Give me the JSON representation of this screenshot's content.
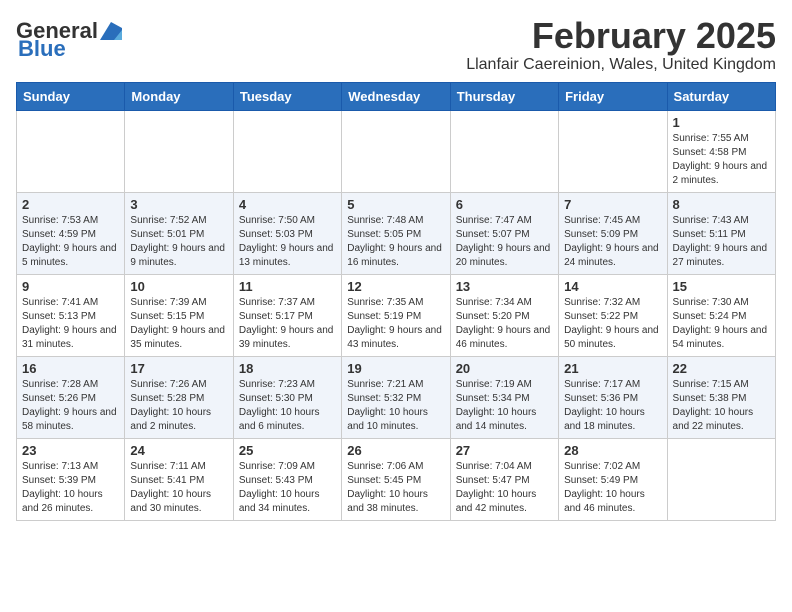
{
  "header": {
    "logo_general": "General",
    "logo_blue": "Blue",
    "month_year": "February 2025",
    "location": "Llanfair Caereinion, Wales, United Kingdom"
  },
  "days_of_week": [
    "Sunday",
    "Monday",
    "Tuesday",
    "Wednesday",
    "Thursday",
    "Friday",
    "Saturday"
  ],
  "weeks": [
    [
      {
        "day": "",
        "info": ""
      },
      {
        "day": "",
        "info": ""
      },
      {
        "day": "",
        "info": ""
      },
      {
        "day": "",
        "info": ""
      },
      {
        "day": "",
        "info": ""
      },
      {
        "day": "",
        "info": ""
      },
      {
        "day": "1",
        "info": "Sunrise: 7:55 AM\nSunset: 4:58 PM\nDaylight: 9 hours and 2 minutes."
      }
    ],
    [
      {
        "day": "2",
        "info": "Sunrise: 7:53 AM\nSunset: 4:59 PM\nDaylight: 9 hours and 5 minutes."
      },
      {
        "day": "3",
        "info": "Sunrise: 7:52 AM\nSunset: 5:01 PM\nDaylight: 9 hours and 9 minutes."
      },
      {
        "day": "4",
        "info": "Sunrise: 7:50 AM\nSunset: 5:03 PM\nDaylight: 9 hours and 13 minutes."
      },
      {
        "day": "5",
        "info": "Sunrise: 7:48 AM\nSunset: 5:05 PM\nDaylight: 9 hours and 16 minutes."
      },
      {
        "day": "6",
        "info": "Sunrise: 7:47 AM\nSunset: 5:07 PM\nDaylight: 9 hours and 20 minutes."
      },
      {
        "day": "7",
        "info": "Sunrise: 7:45 AM\nSunset: 5:09 PM\nDaylight: 9 hours and 24 minutes."
      },
      {
        "day": "8",
        "info": "Sunrise: 7:43 AM\nSunset: 5:11 PM\nDaylight: 9 hours and 27 minutes."
      }
    ],
    [
      {
        "day": "9",
        "info": "Sunrise: 7:41 AM\nSunset: 5:13 PM\nDaylight: 9 hours and 31 minutes."
      },
      {
        "day": "10",
        "info": "Sunrise: 7:39 AM\nSunset: 5:15 PM\nDaylight: 9 hours and 35 minutes."
      },
      {
        "day": "11",
        "info": "Sunrise: 7:37 AM\nSunset: 5:17 PM\nDaylight: 9 hours and 39 minutes."
      },
      {
        "day": "12",
        "info": "Sunrise: 7:35 AM\nSunset: 5:19 PM\nDaylight: 9 hours and 43 minutes."
      },
      {
        "day": "13",
        "info": "Sunrise: 7:34 AM\nSunset: 5:20 PM\nDaylight: 9 hours and 46 minutes."
      },
      {
        "day": "14",
        "info": "Sunrise: 7:32 AM\nSunset: 5:22 PM\nDaylight: 9 hours and 50 minutes."
      },
      {
        "day": "15",
        "info": "Sunrise: 7:30 AM\nSunset: 5:24 PM\nDaylight: 9 hours and 54 minutes."
      }
    ],
    [
      {
        "day": "16",
        "info": "Sunrise: 7:28 AM\nSunset: 5:26 PM\nDaylight: 9 hours and 58 minutes."
      },
      {
        "day": "17",
        "info": "Sunrise: 7:26 AM\nSunset: 5:28 PM\nDaylight: 10 hours and 2 minutes."
      },
      {
        "day": "18",
        "info": "Sunrise: 7:23 AM\nSunset: 5:30 PM\nDaylight: 10 hours and 6 minutes."
      },
      {
        "day": "19",
        "info": "Sunrise: 7:21 AM\nSunset: 5:32 PM\nDaylight: 10 hours and 10 minutes."
      },
      {
        "day": "20",
        "info": "Sunrise: 7:19 AM\nSunset: 5:34 PM\nDaylight: 10 hours and 14 minutes."
      },
      {
        "day": "21",
        "info": "Sunrise: 7:17 AM\nSunset: 5:36 PM\nDaylight: 10 hours and 18 minutes."
      },
      {
        "day": "22",
        "info": "Sunrise: 7:15 AM\nSunset: 5:38 PM\nDaylight: 10 hours and 22 minutes."
      }
    ],
    [
      {
        "day": "23",
        "info": "Sunrise: 7:13 AM\nSunset: 5:39 PM\nDaylight: 10 hours and 26 minutes."
      },
      {
        "day": "24",
        "info": "Sunrise: 7:11 AM\nSunset: 5:41 PM\nDaylight: 10 hours and 30 minutes."
      },
      {
        "day": "25",
        "info": "Sunrise: 7:09 AM\nSunset: 5:43 PM\nDaylight: 10 hours and 34 minutes."
      },
      {
        "day": "26",
        "info": "Sunrise: 7:06 AM\nSunset: 5:45 PM\nDaylight: 10 hours and 38 minutes."
      },
      {
        "day": "27",
        "info": "Sunrise: 7:04 AM\nSunset: 5:47 PM\nDaylight: 10 hours and 42 minutes."
      },
      {
        "day": "28",
        "info": "Sunrise: 7:02 AM\nSunset: 5:49 PM\nDaylight: 10 hours and 46 minutes."
      },
      {
        "day": "",
        "info": ""
      }
    ]
  ]
}
